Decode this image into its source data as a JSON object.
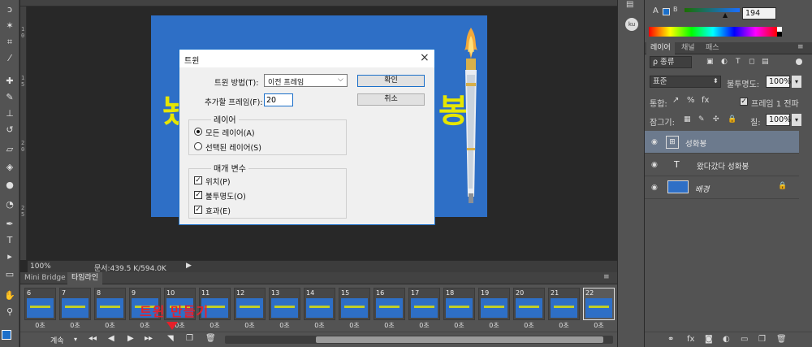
{
  "toolbar": {
    "tools": [
      "lasso-icon",
      "magic-wand-icon",
      "crop-icon",
      "eyedropper-icon",
      "healing-brush-icon",
      "brush-icon",
      "clone-stamp-icon",
      "history-brush-icon",
      "eraser-icon",
      "paint-bucket-icon",
      "blur-icon",
      "dodge-icon",
      "pen-icon",
      "type-icon",
      "path-select-icon",
      "rectangle-icon",
      "hand-icon",
      "zoom-icon"
    ],
    "foreground_color": "#1b6fc9",
    "background_color": "#ffffff"
  },
  "ruler": {
    "marks": [
      "1",
      "0",
      "1",
      "5",
      "2",
      "0",
      "2",
      "5"
    ]
  },
  "canvas": {
    "background_color": "#2e6fc6",
    "text_left": "놨",
    "text_right": "봉",
    "accent_color": "#e6e600"
  },
  "statusbar": {
    "zoom": "100%",
    "doc_info": "문서:439.5 K/594.0K"
  },
  "dialog": {
    "title": "트윈",
    "method_label": "트윈 방법(T):",
    "method_value": "이전 프레임",
    "frames_label": "추가할 프레임(F):",
    "frames_value": "20",
    "ok_label": "확인",
    "cancel_label": "취소",
    "layers_group": "레이어",
    "all_layers": "모든 레이어(A)",
    "selected_layers": "선택된 레이어(S)",
    "params_group": "매개 변수",
    "param_position": "위치(P)",
    "param_opacity": "불투명도(O)",
    "param_effects": "효과(E)"
  },
  "timeline": {
    "tabs": [
      "Mini Bridge",
      "타임라인"
    ],
    "active_tab": "타임라인",
    "frames": [
      {
        "num": "6",
        "delay": "0초"
      },
      {
        "num": "7",
        "delay": "0초"
      },
      {
        "num": "8",
        "delay": "0초"
      },
      {
        "num": "9",
        "delay": "0초"
      },
      {
        "num": "10",
        "delay": "0초"
      },
      {
        "num": "11",
        "delay": "0초"
      },
      {
        "num": "12",
        "delay": "0초"
      },
      {
        "num": "13",
        "delay": "0초"
      },
      {
        "num": "14",
        "delay": "0초"
      },
      {
        "num": "15",
        "delay": "0초"
      },
      {
        "num": "16",
        "delay": "0초"
      },
      {
        "num": "17",
        "delay": "0초"
      },
      {
        "num": "18",
        "delay": "0초"
      },
      {
        "num": "19",
        "delay": "0초"
      },
      {
        "num": "20",
        "delay": "0초"
      },
      {
        "num": "21",
        "delay": "0초"
      },
      {
        "num": "22",
        "delay": "0초"
      }
    ],
    "loop_label": "계속",
    "annotation": "트윈 만들기"
  },
  "color_panel": {
    "channel_label": "B",
    "value": "194"
  },
  "layers": {
    "tabs": [
      "레이어",
      "채널",
      "패스"
    ],
    "filter_label": "ρ 종류",
    "blend_mode": "표준",
    "opacity_label": "불투명도:",
    "opacity_value": "100%",
    "unify_label": "통합:",
    "propagate_label": "프레임 1 전파",
    "lock_label": "잠그기:",
    "fill_label": "칠:",
    "fill_value": "100%",
    "items": [
      {
        "name": "성화봉",
        "type": "smart"
      },
      {
        "name": "왔다갔다 성화봉",
        "type": "text"
      },
      {
        "name": "배경",
        "type": "background"
      }
    ]
  }
}
